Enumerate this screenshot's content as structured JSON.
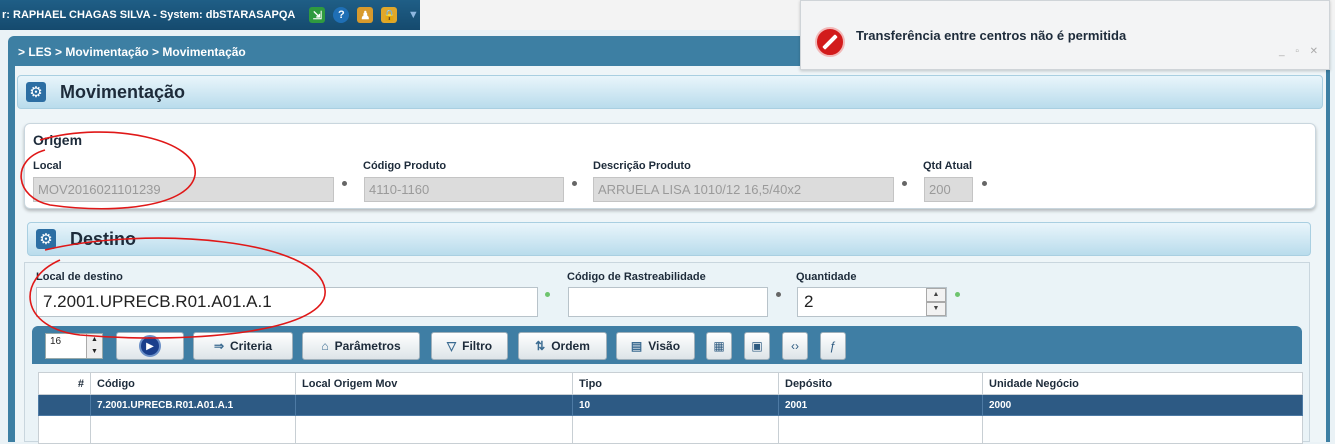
{
  "topbar": {
    "user_system": "r: RAPHAEL CHAGAS SILVA - System: dbSTARASAPQA"
  },
  "breadcrumb": "> LES > Movimentação > Movimentação",
  "page_title": "Movimentação",
  "origem": {
    "legend": "Origem",
    "local_label": "Local",
    "local_value": "MOV2016021101239",
    "codigo_produto_label": "Código Produto",
    "codigo_produto_value": "4110-1160",
    "descricao_label": "Descrição Produto",
    "descricao_value": "ARRUELA LISA 1010/12 16,5/40x2",
    "qtd_label": "Qtd Atual",
    "qtd_value": "200"
  },
  "destino": {
    "title": "Destino",
    "local_destino_label": "Local de destino",
    "local_destino_value": "7.2001.UPRECB.R01.A01.A.1",
    "rastreabilidade_label": "Código de Rastreabilidade",
    "rastreabilidade_value": "",
    "quantidade_label": "Quantidade",
    "quantidade_value": "2"
  },
  "toolbar": {
    "page_size": "16",
    "criteria": "Criteria",
    "parametros": "Parâmetros",
    "filtro": "Filtro",
    "ordem": "Ordem",
    "visao": "Visão"
  },
  "grid": {
    "columns": [
      "#",
      "Código",
      "Local Origem Mov",
      "Tipo",
      "Depósito",
      "Unidade Negócio"
    ],
    "rows": [
      [
        "",
        "7.2001.UPRECB.R01.A01.A.1",
        "",
        "10",
        "2001",
        "2000"
      ]
    ]
  },
  "toast": {
    "message": "Transferência entre centros não é permitida"
  }
}
